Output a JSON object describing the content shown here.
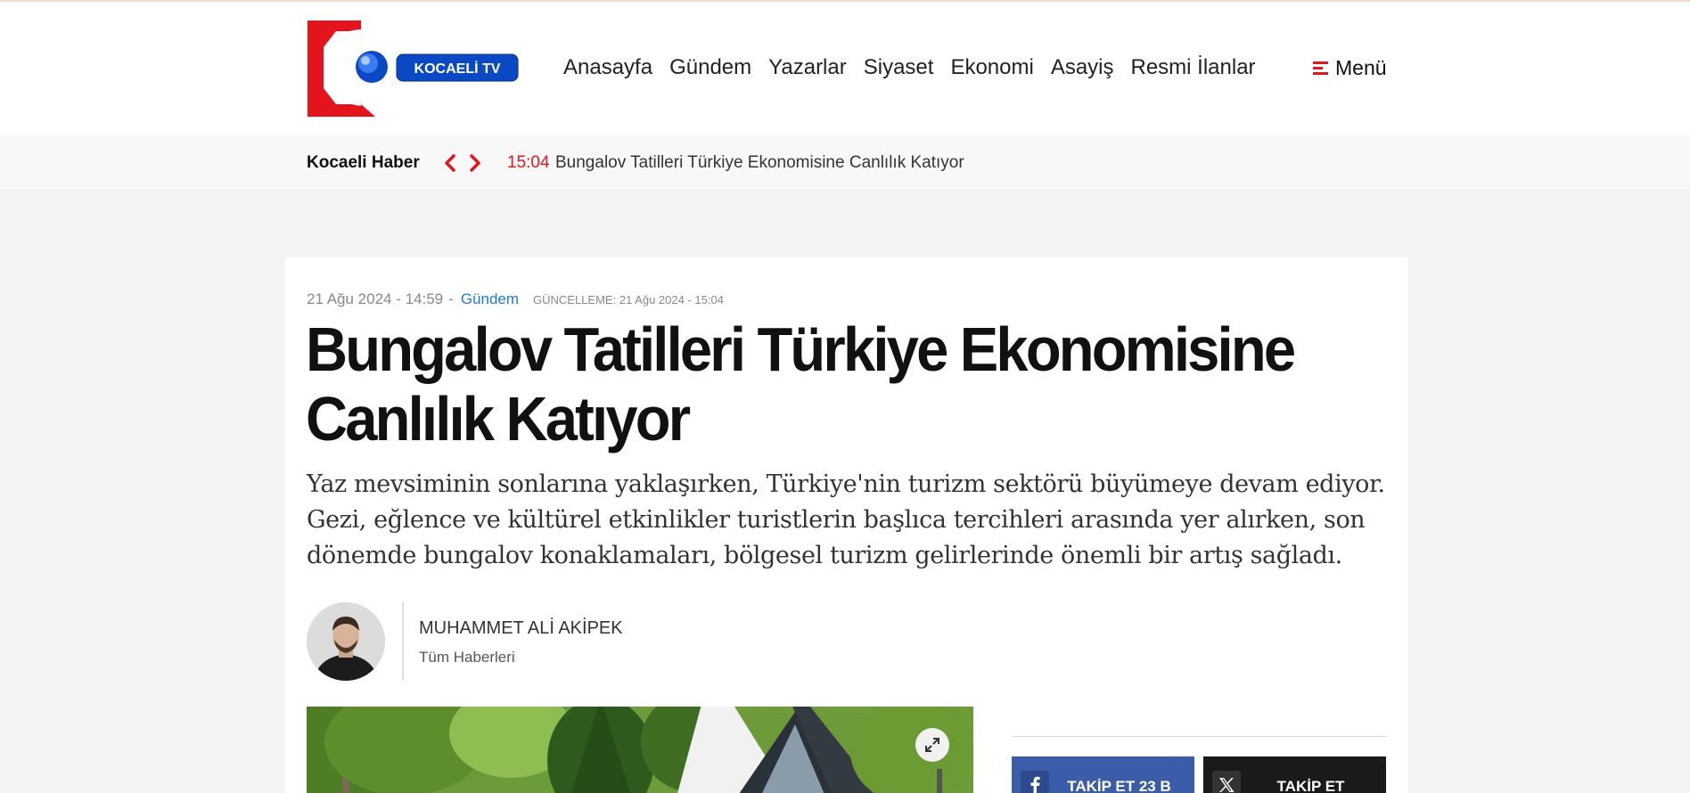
{
  "header": {
    "logo_text": "KOCAELİ TV",
    "nav": [
      "Anasayfa",
      "Gündem",
      "Yazarlar",
      "Siyaset",
      "Ekonomi",
      "Asayiş",
      "Resmi İlanlar"
    ],
    "menu_label": "Menü"
  },
  "ticker": {
    "title": "Kocaeli Haber",
    "time": "15:04",
    "headline": "Bungalov Tatilleri Türkiye Ekonomisine Canlılık Katıyor"
  },
  "article": {
    "date": "21 Ağu 2024 - 14:59",
    "separator": "-",
    "category": "Gündem",
    "updated": "GÜNCELLEME: 21 Ağu 2024 - 15:04",
    "title": "Bungalov Tatilleri Türkiye Ekonomisine Canlılık Katıyor",
    "summary": "Yaz mevsiminin sonlarına yaklaşırken, Türkiye'nin turizm sektörü büyümeye devam ediyor. Gezi, eğlence ve kültürel etkinlikler turistlerin başlıca tercihleri arasında yer alırken, son dönemde bungalov konaklamaları, bölgesel turizm gelirlerinde önemli bir artış sağladı."
  },
  "author": {
    "name": "MUHAMMET ALİ AKİPEK",
    "link": "Tüm Haberleri"
  },
  "social": {
    "facebook_label": "TAKİP ET 23 B",
    "x_label": "TAKİP ET"
  },
  "colors": {
    "accent_red": "#e3161e",
    "link_blue": "#1b7bd4",
    "facebook_blue": "#3b5ca8",
    "x_black": "#1a1a1a",
    "logo_blue": "#0a48c4"
  },
  "icons": {
    "menu": "hamburger-icon",
    "ticker_prev": "chevron-left-icon",
    "ticker_next": "chevron-right-icon",
    "expand": "expand-icon",
    "facebook": "facebook-icon",
    "x": "x-logo-icon"
  }
}
